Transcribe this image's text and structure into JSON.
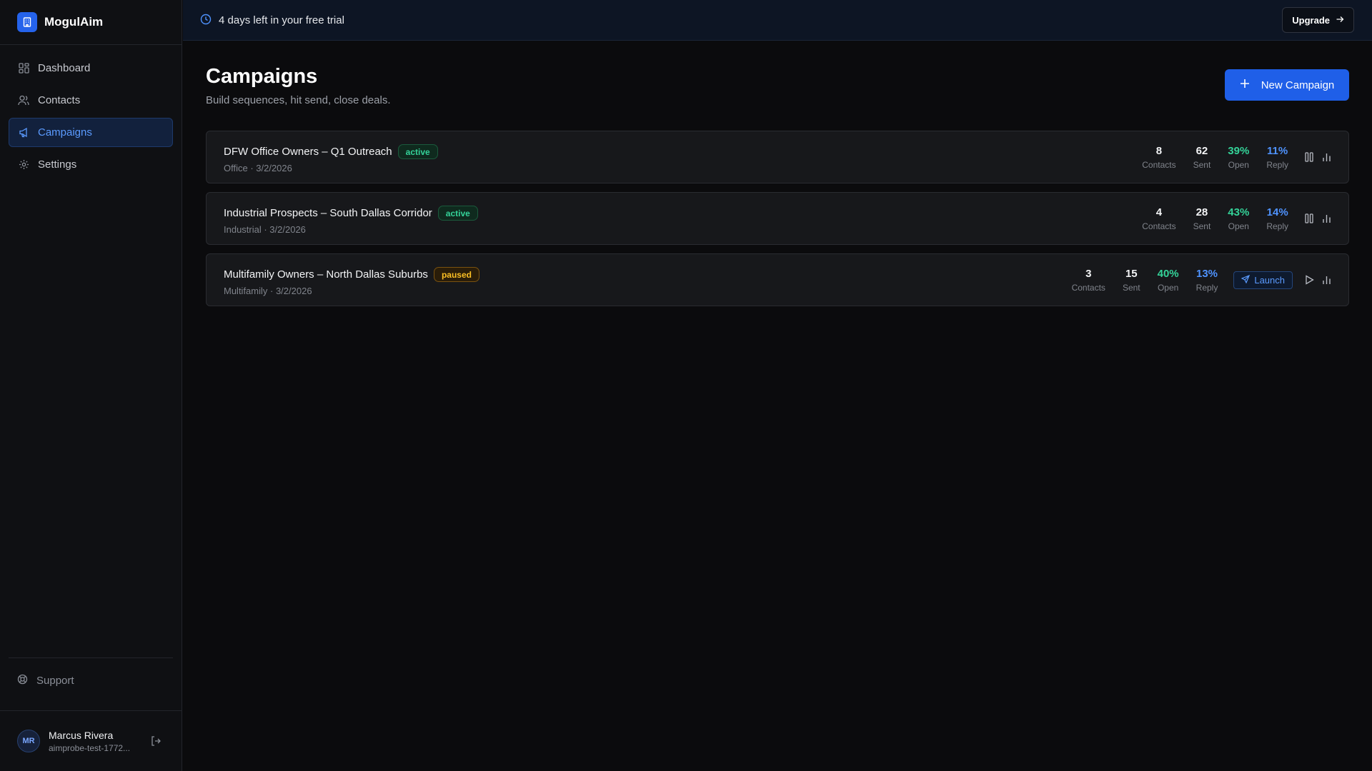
{
  "brand": {
    "name": "MogulAim"
  },
  "nav": [
    {
      "label": "Dashboard",
      "icon": "dashboard-icon",
      "active": false
    },
    {
      "label": "Contacts",
      "icon": "users-icon",
      "active": false
    },
    {
      "label": "Campaigns",
      "icon": "megaphone-icon",
      "active": true
    },
    {
      "label": "Settings",
      "icon": "gear-icon",
      "active": false
    }
  ],
  "support": {
    "label": "Support"
  },
  "user": {
    "initials": "MR",
    "name": "Marcus Rivera",
    "email": "aimprobe-test-1772..."
  },
  "topbar": {
    "trial_text": "4 days left in your free trial",
    "upgrade_label": "Upgrade"
  },
  "page": {
    "title": "Campaigns",
    "subtitle": "Build sequences, hit send, close deals.",
    "new_button_label": "New Campaign"
  },
  "stat_labels": {
    "contacts": "Contacts",
    "sent": "Sent",
    "open": "Open",
    "reply": "Reply"
  },
  "campaigns": [
    {
      "name": "DFW Office Owners – Q1 Outreach",
      "status": "active",
      "meta": "Office · 3/2/2026",
      "contacts": "8",
      "sent": "62",
      "open": "39%",
      "reply": "11%"
    },
    {
      "name": "Industrial Prospects – South Dallas Corridor",
      "status": "active",
      "meta": "Industrial · 3/2/2026",
      "contacts": "4",
      "sent": "28",
      "open": "43%",
      "reply": "14%"
    },
    {
      "name": "Multifamily Owners – North Dallas Suburbs",
      "status": "paused",
      "meta": "Multifamily · 3/2/2026",
      "contacts": "3",
      "sent": "15",
      "open": "40%",
      "reply": "13%",
      "launch_label": "Launch"
    }
  ],
  "colors": {
    "accent": "#1f5fe8",
    "active_badge": "#34d399",
    "paused_badge": "#fbbf24",
    "open_rate": "#34d399",
    "reply_rate": "#4f93ff"
  }
}
